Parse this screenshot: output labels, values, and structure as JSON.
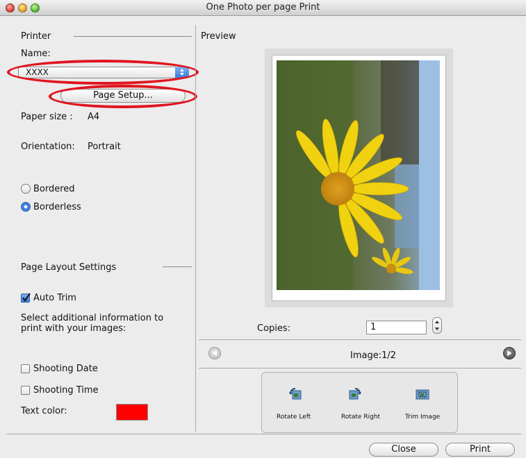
{
  "window": {
    "title": "One Photo per page Print"
  },
  "printer": {
    "section_label": "Printer",
    "name_label": "Name:",
    "printer_name": "XXXX",
    "page_setup_label": "Page Setup...",
    "paper_size_label": "Paper size :",
    "paper_size_value": "A4",
    "orientation_label": "Orientation:",
    "orientation_value": "Portrait",
    "border_options": [
      {
        "label": "Bordered",
        "selected": false
      },
      {
        "label": "Borderless",
        "selected": true
      }
    ]
  },
  "layout": {
    "section_label": "Page Layout Settings",
    "auto_trim_label": "Auto Trim",
    "auto_trim_checked": true,
    "info_text_line1": "Select additional information to",
    "info_text_line2": "print with your images:",
    "shooting_date_label": "Shooting Date",
    "shooting_date_checked": false,
    "shooting_time_label": "Shooting Time",
    "shooting_time_checked": false,
    "text_color_label": "Text color:",
    "text_color": "#ff0000"
  },
  "preview": {
    "section_label": "Preview",
    "copies_label": "Copies:",
    "copies_value": "1",
    "image_counter": "Image:1/2",
    "tools": [
      {
        "label": "Rotate Left",
        "icon": "rotate-left-icon"
      },
      {
        "label": "Rotate Right",
        "icon": "rotate-right-icon"
      },
      {
        "label": "Trim Image",
        "icon": "trim-image-icon"
      }
    ]
  },
  "footer": {
    "close_label": "Close",
    "print_label": "Print"
  },
  "colors": {
    "highlight_ellipse": "#e0151f",
    "accent": "#3b78d8"
  }
}
